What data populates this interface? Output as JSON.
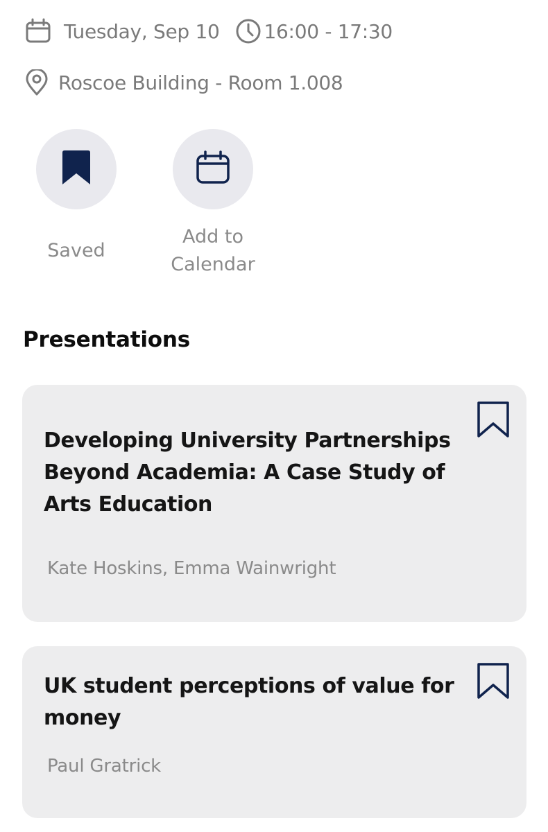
{
  "session": {
    "date": "Tuesday, Sep 10",
    "time": "16:00 - 17:30",
    "location": "Roscoe Building - Room 1.008"
  },
  "actions": {
    "saved_label": "Saved",
    "calendar_label_line1": "Add to",
    "calendar_label_line2": "Calendar"
  },
  "presentations": {
    "heading": "Presentations",
    "items": [
      {
        "title": "Developing University Partnerships Beyond Academia: A Case Study of Arts Education",
        "authors": "Kate Hoskins, Emma Wainwright",
        "saved": false
      },
      {
        "title": "UK student perceptions of value for money",
        "authors": "Paul Gratrick",
        "saved": false
      }
    ]
  },
  "colors": {
    "accent": "#10234d",
    "muted_text": "#7a7a7a",
    "card_bg": "#ededee",
    "circle_bg": "#e9e9ee"
  },
  "icons": {
    "date": "calendar-icon",
    "time": "clock-icon",
    "location": "location-pin-icon",
    "saved": "bookmark-filled-icon",
    "calendar": "calendar-add-icon",
    "card_bookmark": "bookmark-outline-icon"
  }
}
